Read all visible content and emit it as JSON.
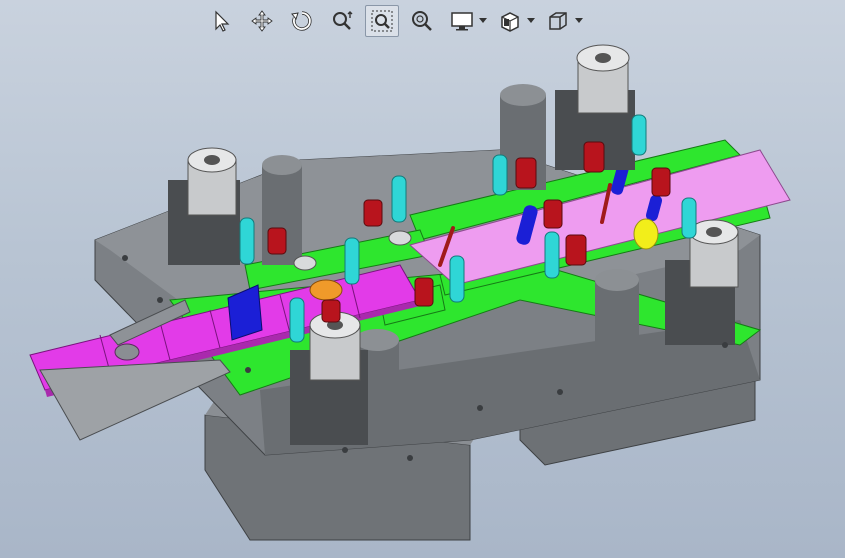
{
  "toolbar": {
    "tools": [
      {
        "name": "select-pointer",
        "icon": "arrow-cursor-icon"
      },
      {
        "name": "pan",
        "icon": "move-arrows-icon"
      },
      {
        "name": "rotate",
        "icon": "rotate-icon"
      },
      {
        "name": "zoom-dynamic",
        "icon": "zoom-arrows-icon"
      },
      {
        "name": "zoom-window",
        "icon": "zoom-box-icon",
        "active": true
      },
      {
        "name": "zoom-fit",
        "icon": "zoom-fit-icon"
      },
      {
        "name": "display-mode",
        "icon": "monitor-icon",
        "dropdown": true
      },
      {
        "name": "view-orientation",
        "icon": "view-orientation-icon",
        "dropdown": true
      },
      {
        "name": "standard-views",
        "icon": "cube-icon",
        "dropdown": true
      }
    ]
  },
  "scene": {
    "description_colors": {
      "background_top": "#c9d2de",
      "background_bottom": "#a9b6c8",
      "die_plate": "#7f8388",
      "die_plate_dark": "#5e6266",
      "strip_magenta": "#e23be8",
      "strip_pink": "#ee9cf0",
      "guide_green": "#2ee62e",
      "spring_red": "#b8141d",
      "bolt_cyan": "#2fd6d6",
      "punch_blue": "#1b1fd6",
      "pin_yellow": "#f2ee1a"
    }
  }
}
